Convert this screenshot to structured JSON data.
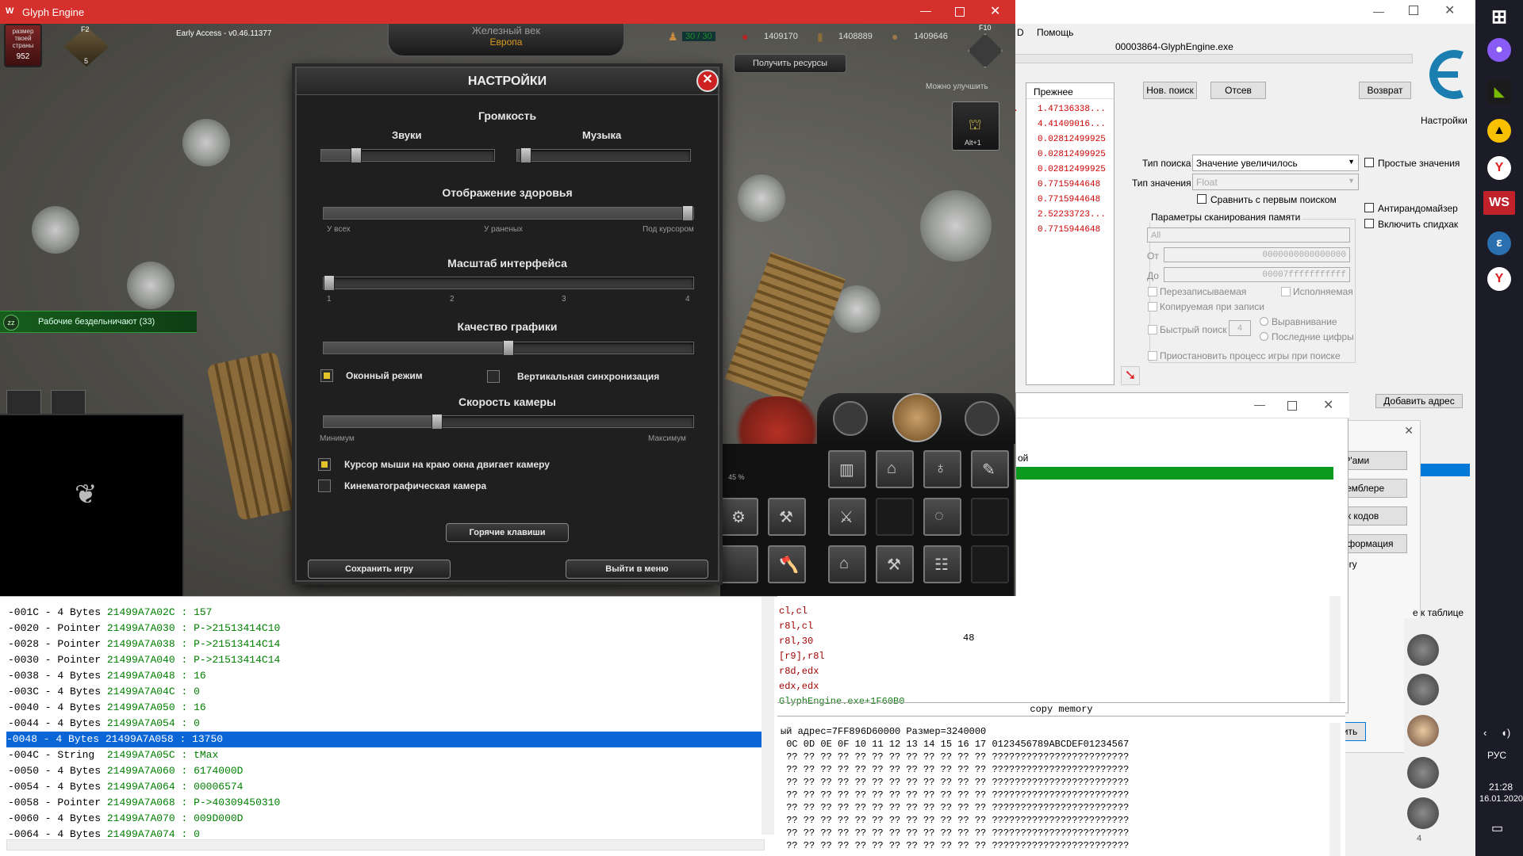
{
  "game": {
    "window_title": "Glyph Engine",
    "version": "Early Access - v0.46.11377",
    "country_label": "размер твоей страны",
    "country_size": "952",
    "era": "Железный век",
    "region": "Европа",
    "food": "30 / 30",
    "res1": "1409170",
    "res2": "1408889",
    "res3": "1409646",
    "f2": "F2",
    "f10": "F10",
    "level_badge": "5",
    "get_resources": "Получить ресурсы",
    "can_upgrade": "Можно улучшить",
    "alt_label": "Alt+1",
    "idle_workers": "Рабочие бездельничают (33)",
    "progress": "45 %"
  },
  "settings": {
    "title": "НАСТРОЙКИ",
    "volume": "Громкость",
    "sounds": "Звуки",
    "music": "Музыка",
    "sounds_level": 0.18,
    "music_level": 0.02,
    "health_title": "Отображение здоровья",
    "health_level": 1.0,
    "health_ticks": [
      "У всех",
      "У раненых",
      "Под курсором"
    ],
    "ui_scale_title": "Масштаб интерфейса",
    "ui_scale_level": 0.0,
    "ui_scale_ticks": [
      "1",
      "2",
      "3",
      "4"
    ],
    "quality_title": "Качество графики",
    "quality_level": 0.5,
    "windowed": "Оконный режим",
    "windowed_on": true,
    "vsync": "Вертикальная синхронизация",
    "vsync_on": false,
    "camera_title": "Скорость камеры",
    "camera_level": 0.3,
    "camera_min": "Минимум",
    "camera_max": "Максимум",
    "edge_scroll": "Курсор мыши на краю окна двигает камеру",
    "edge_scroll_on": true,
    "cinematic": "Кинематографическая камера",
    "cinematic_on": false,
    "hotkeys": "Горячие клавиши",
    "save": "Сохранить игру",
    "exit": "Выйти в меню"
  },
  "ce": {
    "menu_d": "D",
    "menu_help": "Помощь",
    "process": "00003864-GlyphEngine.exe",
    "col_prev": "Прежнее",
    "prev_values": [
      "1.47136338...",
      "4.41409016...",
      "0.02812499925",
      "0.02812499925",
      "0.02812499925",
      "0.7715944648",
      "0.7715944648",
      "2.52233723...",
      "0.7715944648"
    ],
    "new_scan": "Нов. поиск",
    "next_scan": "Отсев",
    "undo": "Возврат",
    "settings": "Настройки",
    "scan_type_label": "Тип поиска",
    "scan_type": "Значение увеличилось",
    "value_type_label": "Тип значения",
    "value_type": "Float",
    "simple_values": "Простые значения",
    "compare_first": "Сравнить с первым поиском",
    "anti_random": "Антирандомайзер",
    "speedhack": "Включить спидхак",
    "mem_params": "Параметры сканирования памяти",
    "mem_all": "All",
    "from_label": "От",
    "from": "0000000000000000",
    "to_label": "До",
    "to": "00007fffffffffff",
    "writable": "Перезаписываемая",
    "executable": "Исполняемая",
    "cow": "Копируемая при записи",
    "fast_scan": "Быстрый поиск",
    "fast_val": "4",
    "alignment": "Выравнивание",
    "last_digits": "Последние цифры",
    "pause": "Приостановить процесс игры при поиске",
    "add_address": "Добавить адрес",
    "to_table": "е к таблице",
    "opcode_fragment": "ой",
    "side_btn1": "OP'ами",
    "side_btn2": "ссемблере",
    "side_btn3": "сок кодов",
    "side_btn4": "информация",
    "side_text": "mory",
    "side_btn5": "ить",
    "ce_logo_text": "Cheat Engine"
  },
  "memory_rows": [
    {
      "o": "-001C - 4 Bytes",
      "a": "21499A7A02C",
      "v": " : 157"
    },
    {
      "o": "-0020 - Pointer",
      "a": "21499A7A030",
      "v": " : P->21513414C10"
    },
    {
      "o": "-0028 - Pointer",
      "a": "21499A7A038",
      "v": " : P->21513414C14"
    },
    {
      "o": "-0030 - Pointer",
      "a": "21499A7A040",
      "v": " : P->21513414C14"
    },
    {
      "o": "-0038 - 4 Bytes",
      "a": "21499A7A048",
      "v": " : 16"
    },
    {
      "o": "-003C - 4 Bytes",
      "a": "21499A7A04C",
      "v": " : 0"
    },
    {
      "o": "-0040 - 4 Bytes",
      "a": "21499A7A050",
      "v": " : 16"
    },
    {
      "o": "-0044 - 4 Bytes",
      "a": "21499A7A054",
      "v": " : 0"
    },
    {
      "o": "-0048 - 4 Bytes",
      "a": "21499A7A058",
      "v": " : 13750"
    },
    {
      "o": "-004C - String ",
      "a": "21499A7A05C",
      "v": " : tMax"
    },
    {
      "o": "-0050 - 4 Bytes",
      "a": "21499A7A060",
      "v": " : 6174000D"
    },
    {
      "o": "-0054 - 4 Bytes",
      "a": "21499A7A064",
      "v": " : 00006574"
    },
    {
      "o": "-0058 - Pointer",
      "a": "21499A7A068",
      "v": " : P->40309450310"
    },
    {
      "o": "-0060 - 4 Bytes",
      "a": "21499A7A070",
      "v": " : 009D000D"
    },
    {
      "o": "-0064 - 4 Bytes",
      "a": "21499A7A074",
      "v": " : 0"
    }
  ],
  "asm_lines": [
    "cl,cl",
    "r8l,cl",
    "r8l,30",
    "[r9],r8l",
    "r8d,edx",
    "edx,edx",
    "GlyphEngine.exe+1F60B0"
  ],
  "asm_extra": "48",
  "copy_memory": "copy memory",
  "hex_header": "ый адрес=7FF896D60000 Размер=3240000",
  "hex_cols": " 0C 0D 0E 0F 10 11 12 13 14 15 16 17 0123456789ABCDEF01234567",
  "hex_row": " ?? ?? ?? ?? ?? ?? ?? ?? ?? ?? ?? ?? ????????????????????????",
  "taskbar": {
    "lang": "РУС",
    "time": "21:28",
    "date": "16.01.2020"
  },
  "chat_count": "4"
}
